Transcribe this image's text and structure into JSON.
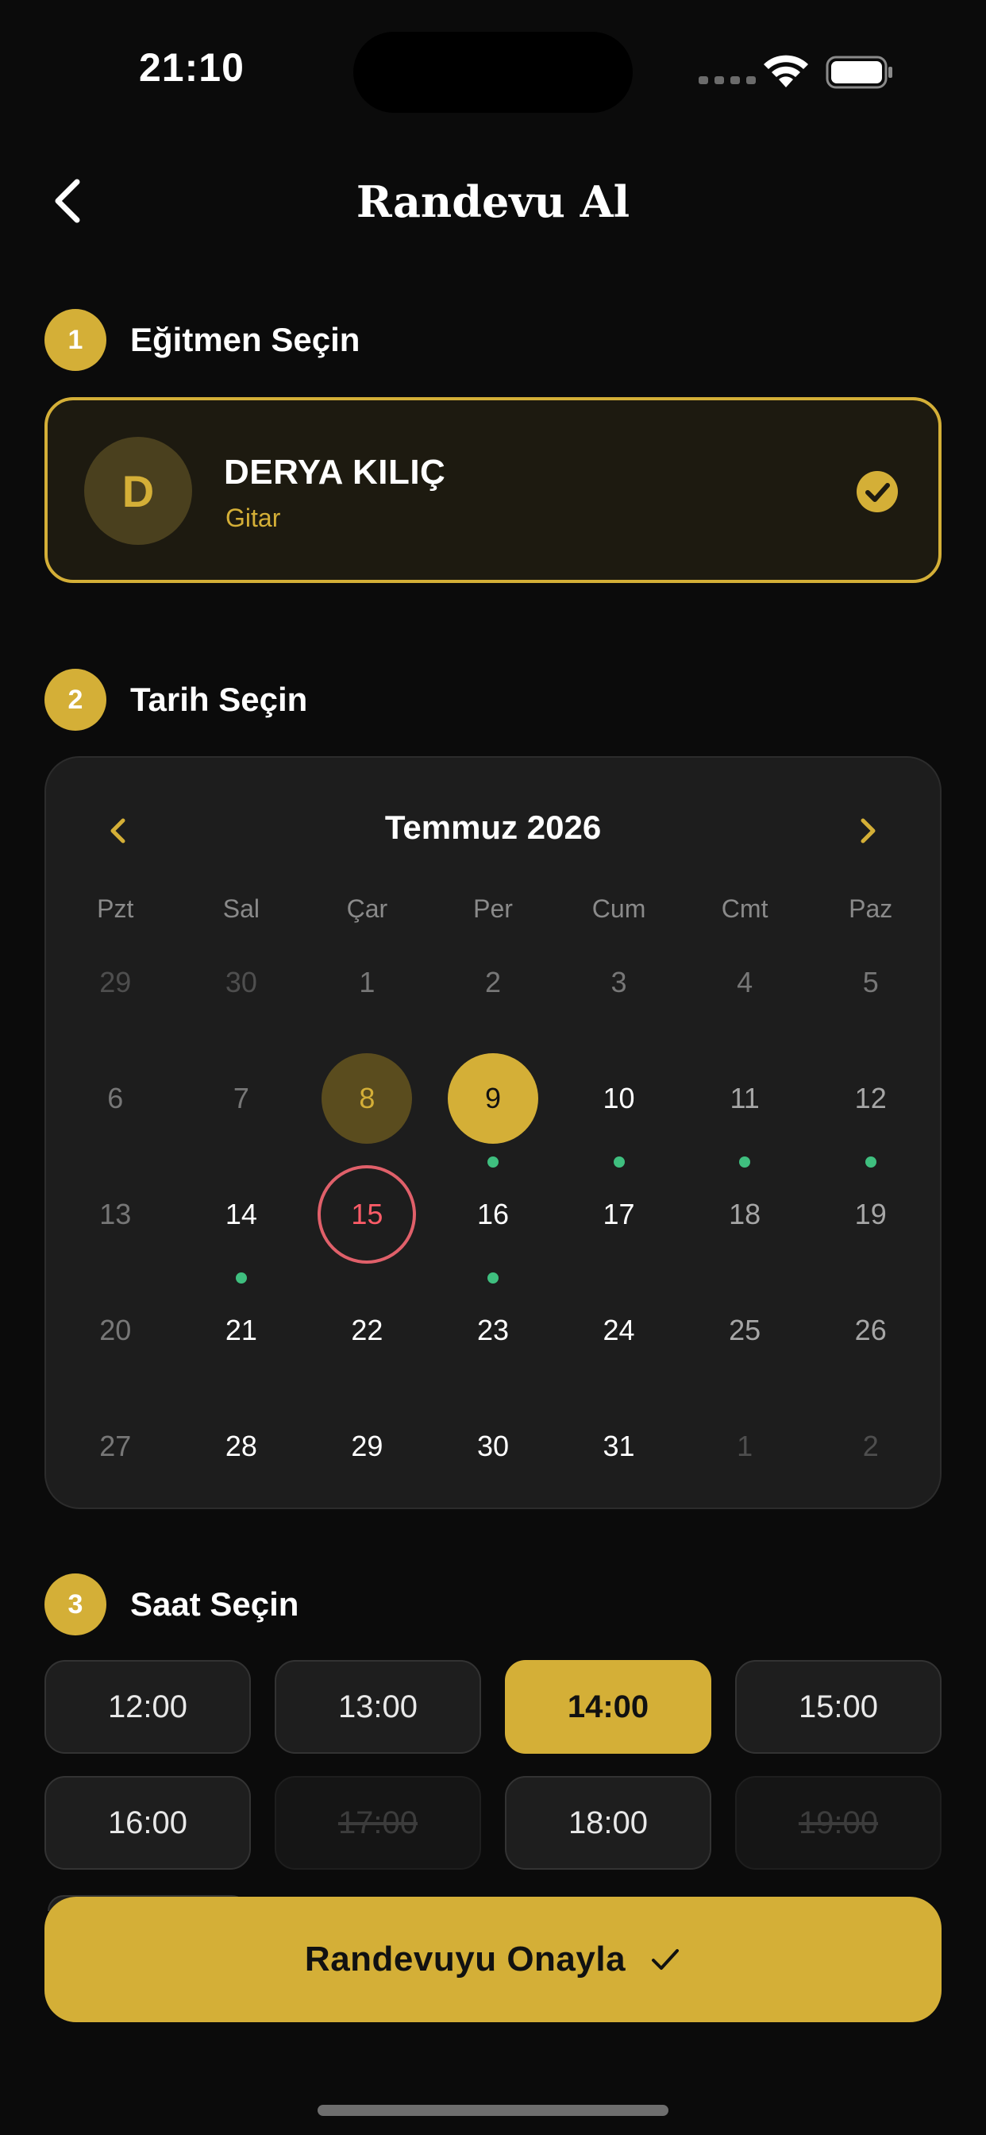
{
  "status_bar": {
    "time": "21:10"
  },
  "header": {
    "title": "Randevu Al"
  },
  "steps": [
    {
      "number": "1",
      "label": "Eğitmen Seçin"
    },
    {
      "number": "2",
      "label": "Tarih Seçin"
    },
    {
      "number": "3",
      "label": "Saat Seçin"
    }
  ],
  "instructor": {
    "initial": "D",
    "name": "DERYA KILIÇ",
    "subject": "Gitar",
    "selected": true
  },
  "calendar": {
    "month_label": "Temmuz 2026",
    "weekdays": [
      "Pzt",
      "Sal",
      "Çar",
      "Per",
      "Cum",
      "Cmt",
      "Paz"
    ],
    "days": [
      {
        "n": "29",
        "state": "outside"
      },
      {
        "n": "30",
        "state": "outside"
      },
      {
        "n": "1",
        "state": "muted"
      },
      {
        "n": "2",
        "state": "muted"
      },
      {
        "n": "3",
        "state": "muted"
      },
      {
        "n": "4",
        "state": "muted"
      },
      {
        "n": "5",
        "state": "muted"
      },
      {
        "n": "6",
        "state": "muted"
      },
      {
        "n": "7",
        "state": "muted"
      },
      {
        "n": "8",
        "state": "past-selected"
      },
      {
        "n": "9",
        "state": "selected",
        "dot": true
      },
      {
        "n": "10",
        "state": "avail",
        "dot": true
      },
      {
        "n": "11",
        "state": "faded",
        "dot": true
      },
      {
        "n": "12",
        "state": "faded",
        "dot": true
      },
      {
        "n": "13",
        "state": "muted"
      },
      {
        "n": "14",
        "state": "avail",
        "dot": true
      },
      {
        "n": "15",
        "state": "today"
      },
      {
        "n": "16",
        "state": "avail",
        "dot": true
      },
      {
        "n": "17",
        "state": "avail"
      },
      {
        "n": "18",
        "state": "faded"
      },
      {
        "n": "19",
        "state": "faded"
      },
      {
        "n": "20",
        "state": "muted"
      },
      {
        "n": "21",
        "state": "avail"
      },
      {
        "n": "22",
        "state": "avail"
      },
      {
        "n": "23",
        "state": "avail"
      },
      {
        "n": "24",
        "state": "avail"
      },
      {
        "n": "25",
        "state": "faded"
      },
      {
        "n": "26",
        "state": "faded"
      },
      {
        "n": "27",
        "state": "muted"
      },
      {
        "n": "28",
        "state": "avail"
      },
      {
        "n": "29",
        "state": "avail"
      },
      {
        "n": "30",
        "state": "avail"
      },
      {
        "n": "31",
        "state": "avail"
      },
      {
        "n": "1",
        "state": "outside"
      },
      {
        "n": "2",
        "state": "outside"
      }
    ]
  },
  "time_slots": [
    {
      "time": "12:00",
      "state": "available"
    },
    {
      "time": "13:00",
      "state": "available"
    },
    {
      "time": "14:00",
      "state": "selected"
    },
    {
      "time": "15:00",
      "state": "available"
    },
    {
      "time": "16:00",
      "state": "available"
    },
    {
      "time": "17:00",
      "state": "disabled"
    },
    {
      "time": "18:00",
      "state": "available"
    },
    {
      "time": "19:00",
      "state": "disabled"
    }
  ],
  "confirm_button": {
    "label": "Randevuyu Onayla"
  },
  "colors": {
    "accent": "#d4af37",
    "background": "#0b0b0b",
    "card": "#1d1d1d",
    "available_dot": "#3fbf7f",
    "today_ring": "#e0606a"
  },
  "icons": {
    "back": "chevron-left-icon",
    "check": "check-circle-icon",
    "prev_month": "chevron-left-icon",
    "next_month": "chevron-right-icon",
    "confirm": "checkmark-icon"
  }
}
